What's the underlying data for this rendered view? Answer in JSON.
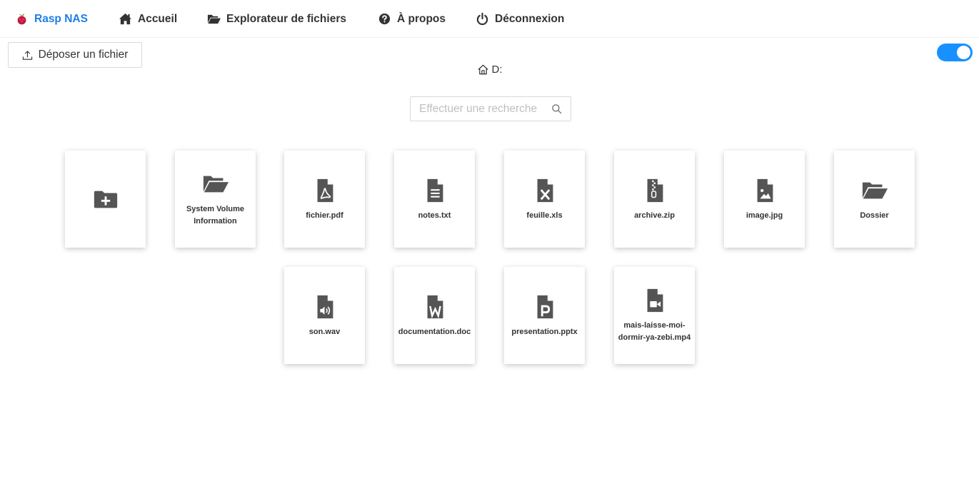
{
  "nav": {
    "brand": "Rasp NAS",
    "home": "Accueil",
    "explorer": "Explorateur de fichiers",
    "about": "À propos",
    "logout": "Déconnexion"
  },
  "toolbar": {
    "upload_label": "Déposer un fichier",
    "toggle_on": true
  },
  "breadcrumb": {
    "path": "D:"
  },
  "search": {
    "placeholder": "Effectuer une recherche",
    "value": ""
  },
  "colors": {
    "accent": "#1f7de8",
    "toggle": "#1890ff",
    "icon": "#555555"
  },
  "files": [
    {
      "name": "",
      "icon": "folder-add-icon"
    },
    {
      "name": "System Volume Information",
      "icon": "folder-open-icon"
    },
    {
      "name": "fichier.pdf",
      "icon": "file-pdf-icon"
    },
    {
      "name": "notes.txt",
      "icon": "file-text-icon"
    },
    {
      "name": "feuille.xls",
      "icon": "file-excel-icon"
    },
    {
      "name": "archive.zip",
      "icon": "file-zip-icon"
    },
    {
      "name": "image.jpg",
      "icon": "file-image-icon"
    },
    {
      "name": "Dossier",
      "icon": "folder-open-icon"
    },
    {
      "name": "son.wav",
      "icon": "file-audio-icon"
    },
    {
      "name": "documentation.doc",
      "icon": "file-word-icon"
    },
    {
      "name": "presentation.pptx",
      "icon": "file-powerpoint-icon"
    },
    {
      "name": "mais-laisse-moi-dormir-ya-zebi.mp4",
      "icon": "file-video-icon"
    }
  ]
}
